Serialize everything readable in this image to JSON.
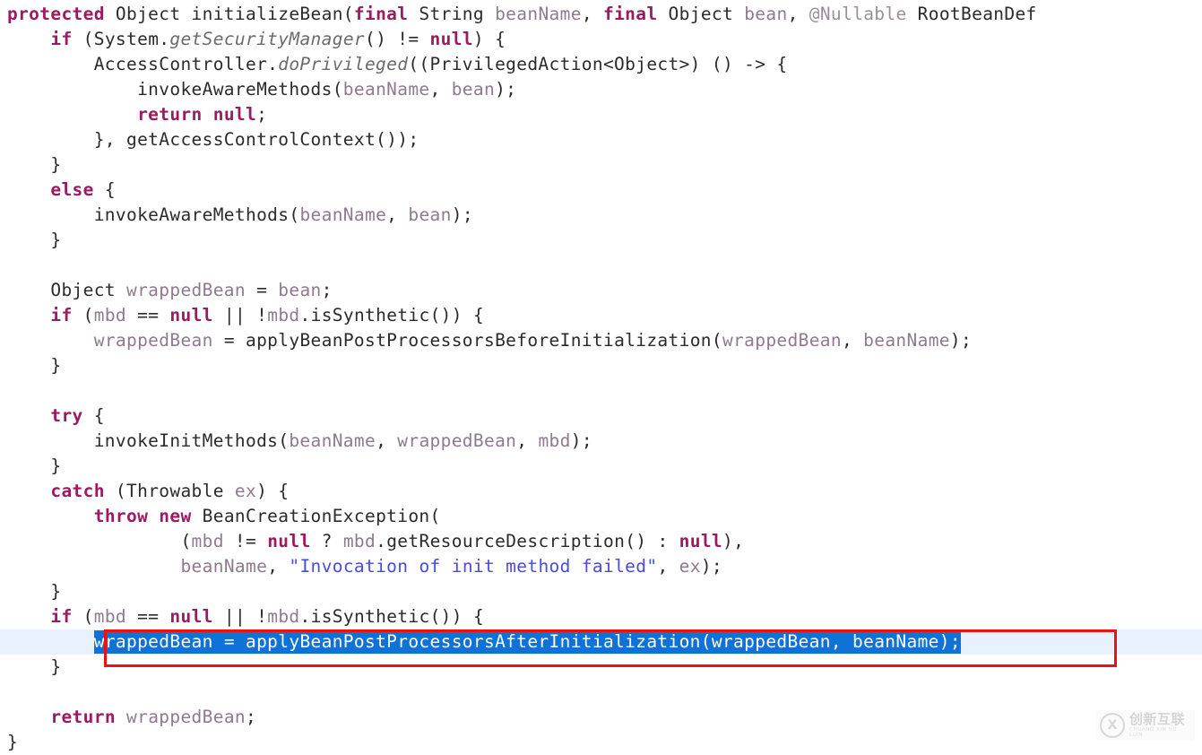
{
  "editor": {
    "language": "java",
    "file_kind": "java-source-code-view",
    "background_color": "#ffffff",
    "current_line_highlight_color": "#e8f2fe",
    "selection_color": "#1071d6",
    "selection_text_color": "#ffffff",
    "annotation_box_color": "#ee1111",
    "keyword_color": "#9b1b60",
    "identifier_color": "#8e7b8e",
    "string_color": "#4a4ae0",
    "plain_color": "#2b2b2b"
  },
  "code": {
    "lines": [
      {
        "id": "line-1",
        "text": "protected Object initializeBean(final String beanName, final Object bean, @Nullable RootBeanDef",
        "tokens": [
          {
            "t": "protected",
            "c": "kw"
          },
          {
            "t": " Object initializeBean(",
            "c": "plain"
          },
          {
            "t": "final",
            "c": "kw"
          },
          {
            "t": " String ",
            "c": "plain"
          },
          {
            "t": "beanName",
            "c": "ident"
          },
          {
            "t": ", ",
            "c": "plain"
          },
          {
            "t": "final",
            "c": "kw"
          },
          {
            "t": " Object ",
            "c": "plain"
          },
          {
            "t": "bean",
            "c": "ident"
          },
          {
            "t": ", ",
            "c": "plain"
          },
          {
            "t": "@Nullable",
            "c": "anno"
          },
          {
            "t": " RootBeanDef",
            "c": "plain"
          }
        ]
      },
      {
        "id": "line-2",
        "text": "    if (System.getSecurityManager() != null) {",
        "tokens": [
          {
            "t": "    ",
            "c": "plain"
          },
          {
            "t": "if",
            "c": "kw"
          },
          {
            "t": " (System.",
            "c": "plain"
          },
          {
            "t": "getSecurityManager",
            "c": "stat"
          },
          {
            "t": "() != ",
            "c": "plain"
          },
          {
            "t": "null",
            "c": "kw"
          },
          {
            "t": ") {",
            "c": "plain"
          }
        ]
      },
      {
        "id": "line-3",
        "text": "        AccessController.doPrivileged((PrivilegedAction<Object>) () -> {",
        "tokens": [
          {
            "t": "        AccessController.",
            "c": "plain"
          },
          {
            "t": "doPrivileged",
            "c": "stat"
          },
          {
            "t": "((PrivilegedAction<Object>) () -> {",
            "c": "plain"
          }
        ]
      },
      {
        "id": "line-4",
        "text": "            invokeAwareMethods(beanName, bean);",
        "tokens": [
          {
            "t": "            invokeAwareMethods(",
            "c": "plain"
          },
          {
            "t": "beanName",
            "c": "ident"
          },
          {
            "t": ", ",
            "c": "plain"
          },
          {
            "t": "bean",
            "c": "ident"
          },
          {
            "t": ");",
            "c": "plain"
          }
        ]
      },
      {
        "id": "line-5",
        "text": "            return null;",
        "tokens": [
          {
            "t": "            ",
            "c": "plain"
          },
          {
            "t": "return null",
            "c": "kw"
          },
          {
            "t": ";",
            "c": "plain"
          }
        ]
      },
      {
        "id": "line-6",
        "text": "        }, getAccessControlContext());",
        "tokens": [
          {
            "t": "        }, getAccessControlContext());",
            "c": "plain"
          }
        ]
      },
      {
        "id": "line-7",
        "text": "    }",
        "tokens": [
          {
            "t": "    }",
            "c": "plain"
          }
        ]
      },
      {
        "id": "line-8",
        "text": "    else {",
        "tokens": [
          {
            "t": "    ",
            "c": "plain"
          },
          {
            "t": "else",
            "c": "kw"
          },
          {
            "t": " {",
            "c": "plain"
          }
        ]
      },
      {
        "id": "line-9",
        "text": "        invokeAwareMethods(beanName, bean);",
        "tokens": [
          {
            "t": "        invokeAwareMethods(",
            "c": "plain"
          },
          {
            "t": "beanName",
            "c": "ident"
          },
          {
            "t": ", ",
            "c": "plain"
          },
          {
            "t": "bean",
            "c": "ident"
          },
          {
            "t": ");",
            "c": "plain"
          }
        ]
      },
      {
        "id": "line-10",
        "text": "    }",
        "tokens": [
          {
            "t": "    }",
            "c": "plain"
          }
        ]
      },
      {
        "id": "line-11",
        "text": "",
        "tokens": []
      },
      {
        "id": "line-12",
        "text": "    Object wrappedBean = bean;",
        "tokens": [
          {
            "t": "    Object ",
            "c": "plain"
          },
          {
            "t": "wrappedBean",
            "c": "ident"
          },
          {
            "t": " = ",
            "c": "plain"
          },
          {
            "t": "bean",
            "c": "ident"
          },
          {
            "t": ";",
            "c": "plain"
          }
        ]
      },
      {
        "id": "line-13",
        "text": "    if (mbd == null || !mbd.isSynthetic()) {",
        "tokens": [
          {
            "t": "    ",
            "c": "plain"
          },
          {
            "t": "if",
            "c": "kw"
          },
          {
            "t": " (",
            "c": "plain"
          },
          {
            "t": "mbd",
            "c": "ident"
          },
          {
            "t": " == ",
            "c": "plain"
          },
          {
            "t": "null",
            "c": "kw"
          },
          {
            "t": " || !",
            "c": "plain"
          },
          {
            "t": "mbd",
            "c": "ident"
          },
          {
            "t": ".isSynthetic()) {",
            "c": "plain"
          }
        ]
      },
      {
        "id": "line-14",
        "text": "        wrappedBean = applyBeanPostProcessorsBeforeInitialization(wrappedBean, beanName);",
        "tokens": [
          {
            "t": "        ",
            "c": "plain"
          },
          {
            "t": "wrappedBean",
            "c": "ident"
          },
          {
            "t": " = applyBeanPostProcessorsBeforeInitialization(",
            "c": "plain"
          },
          {
            "t": "wrappedBean",
            "c": "ident"
          },
          {
            "t": ", ",
            "c": "plain"
          },
          {
            "t": "beanName",
            "c": "ident"
          },
          {
            "t": ");",
            "c": "plain"
          }
        ]
      },
      {
        "id": "line-15",
        "text": "    }",
        "tokens": [
          {
            "t": "    }",
            "c": "plain"
          }
        ]
      },
      {
        "id": "line-16",
        "text": "",
        "tokens": []
      },
      {
        "id": "line-17",
        "text": "    try {",
        "tokens": [
          {
            "t": "    ",
            "c": "plain"
          },
          {
            "t": "try",
            "c": "kw"
          },
          {
            "t": " {",
            "c": "plain"
          }
        ]
      },
      {
        "id": "line-18",
        "text": "        invokeInitMethods(beanName, wrappedBean, mbd);",
        "tokens": [
          {
            "t": "        invokeInitMethods(",
            "c": "plain"
          },
          {
            "t": "beanName",
            "c": "ident"
          },
          {
            "t": ", ",
            "c": "plain"
          },
          {
            "t": "wrappedBean",
            "c": "ident"
          },
          {
            "t": ", ",
            "c": "plain"
          },
          {
            "t": "mbd",
            "c": "ident"
          },
          {
            "t": ");",
            "c": "plain"
          }
        ]
      },
      {
        "id": "line-19",
        "text": "    }",
        "tokens": [
          {
            "t": "    }",
            "c": "plain"
          }
        ]
      },
      {
        "id": "line-20",
        "text": "    catch (Throwable ex) {",
        "tokens": [
          {
            "t": "    ",
            "c": "plain"
          },
          {
            "t": "catch",
            "c": "kw"
          },
          {
            "t": " (Throwable ",
            "c": "plain"
          },
          {
            "t": "ex",
            "c": "ident"
          },
          {
            "t": ") {",
            "c": "plain"
          }
        ]
      },
      {
        "id": "line-21",
        "text": "        throw new BeanCreationException(",
        "tokens": [
          {
            "t": "        ",
            "c": "plain"
          },
          {
            "t": "throw new",
            "c": "kw"
          },
          {
            "t": " BeanCreationException(",
            "c": "plain"
          }
        ]
      },
      {
        "id": "line-22",
        "text": "                (mbd != null ? mbd.getResourceDescription() : null),",
        "tokens": [
          {
            "t": "                (",
            "c": "plain"
          },
          {
            "t": "mbd",
            "c": "ident"
          },
          {
            "t": " != ",
            "c": "plain"
          },
          {
            "t": "null",
            "c": "kw"
          },
          {
            "t": " ? ",
            "c": "plain"
          },
          {
            "t": "mbd",
            "c": "ident"
          },
          {
            "t": ".getResourceDescription() : ",
            "c": "plain"
          },
          {
            "t": "null",
            "c": "kw"
          },
          {
            "t": "),",
            "c": "plain"
          }
        ]
      },
      {
        "id": "line-23",
        "text": "                beanName, \"Invocation of init method failed\", ex);",
        "tokens": [
          {
            "t": "                ",
            "c": "plain"
          },
          {
            "t": "beanName",
            "c": "ident"
          },
          {
            "t": ", ",
            "c": "plain"
          },
          {
            "t": "\"Invocation of init method failed\"",
            "c": "str"
          },
          {
            "t": ", ",
            "c": "plain"
          },
          {
            "t": "ex",
            "c": "ident"
          },
          {
            "t": ");",
            "c": "plain"
          }
        ]
      },
      {
        "id": "line-24",
        "text": "    }",
        "tokens": [
          {
            "t": "    }",
            "c": "plain"
          }
        ]
      },
      {
        "id": "line-25",
        "text": "    if (mbd == null || !mbd.isSynthetic()) {",
        "tokens": [
          {
            "t": "    ",
            "c": "plain"
          },
          {
            "t": "if",
            "c": "kw"
          },
          {
            "t": " (",
            "c": "plain"
          },
          {
            "t": "mbd",
            "c": "ident"
          },
          {
            "t": " == ",
            "c": "plain"
          },
          {
            "t": "null",
            "c": "kw"
          },
          {
            "t": " || !",
            "c": "plain"
          },
          {
            "t": "mbd",
            "c": "ident"
          },
          {
            "t": ".isSynthetic()) {",
            "c": "plain"
          }
        ]
      },
      {
        "id": "line-26",
        "current": true,
        "text": "        wrappedBean = applyBeanPostProcessorsAfterInitialization(wrappedBean, beanName);",
        "tokens": [
          {
            "t": "        ",
            "c": "plain"
          },
          {
            "t": "wrappedBean = applyBeanPostProcessorsAfterInitialization(wrappedBean, beanName);",
            "c": "sel"
          }
        ]
      },
      {
        "id": "line-27",
        "text": "    }",
        "tokens": [
          {
            "t": "    }",
            "c": "plain"
          }
        ]
      },
      {
        "id": "line-28",
        "text": "",
        "tokens": []
      },
      {
        "id": "line-29",
        "text": "    return wrappedBean;",
        "tokens": [
          {
            "t": "    ",
            "c": "plain"
          },
          {
            "t": "return",
            "c": "kw"
          },
          {
            "t": " ",
            "c": "plain"
          },
          {
            "t": "wrappedBean",
            "c": "ident"
          },
          {
            "t": ";",
            "c": "plain"
          }
        ]
      },
      {
        "id": "line-30",
        "text": "}",
        "tokens": [
          {
            "t": "}",
            "c": "plain"
          }
        ]
      }
    ]
  },
  "annotation": {
    "type": "red-rectangle-highlight",
    "target_line_id": "line-26",
    "label": "applyBeanPostProcessorsAfterInitialization call"
  },
  "watermark": {
    "brand_cn": "创新互联",
    "brand_pinyin": "CHUANG XIN HU LIAN",
    "mark_glyph": "X"
  }
}
